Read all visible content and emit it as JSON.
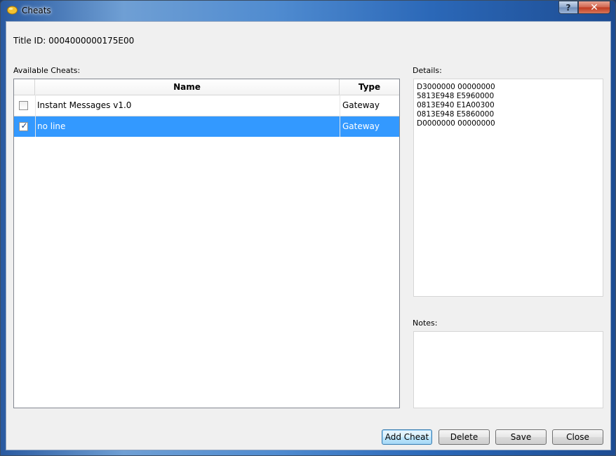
{
  "window": {
    "title": "Cheats",
    "help_glyph": "?",
    "close_glyph": "✕"
  },
  "title_id": "Title ID: 0004000000175E00",
  "available_label": "Available Cheats:",
  "details_label": "Details:",
  "notes_label": "Notes:",
  "table": {
    "headers": {
      "name": "Name",
      "type": "Type"
    },
    "rows": [
      {
        "name": "Instant Messages v1.0",
        "type": "Gateway",
        "checked": false,
        "selected": false
      },
      {
        "name": "no line",
        "type": "Gateway",
        "checked": true,
        "selected": true
      }
    ],
    "check_glyph": "✓"
  },
  "details": {
    "lines": [
      "D3000000 00000000",
      "5813E948 E5960000",
      "0813E940 E1A00300",
      "0813E948 E5860000",
      "D0000000 00000000"
    ]
  },
  "notes": {
    "value": ""
  },
  "buttons": {
    "add": "Add Cheat",
    "delete": "Delete",
    "save": "Save",
    "close": "Close"
  },
  "colors": {
    "selection": "#3399ff",
    "dialog_bg": "#f0f0f0"
  }
}
